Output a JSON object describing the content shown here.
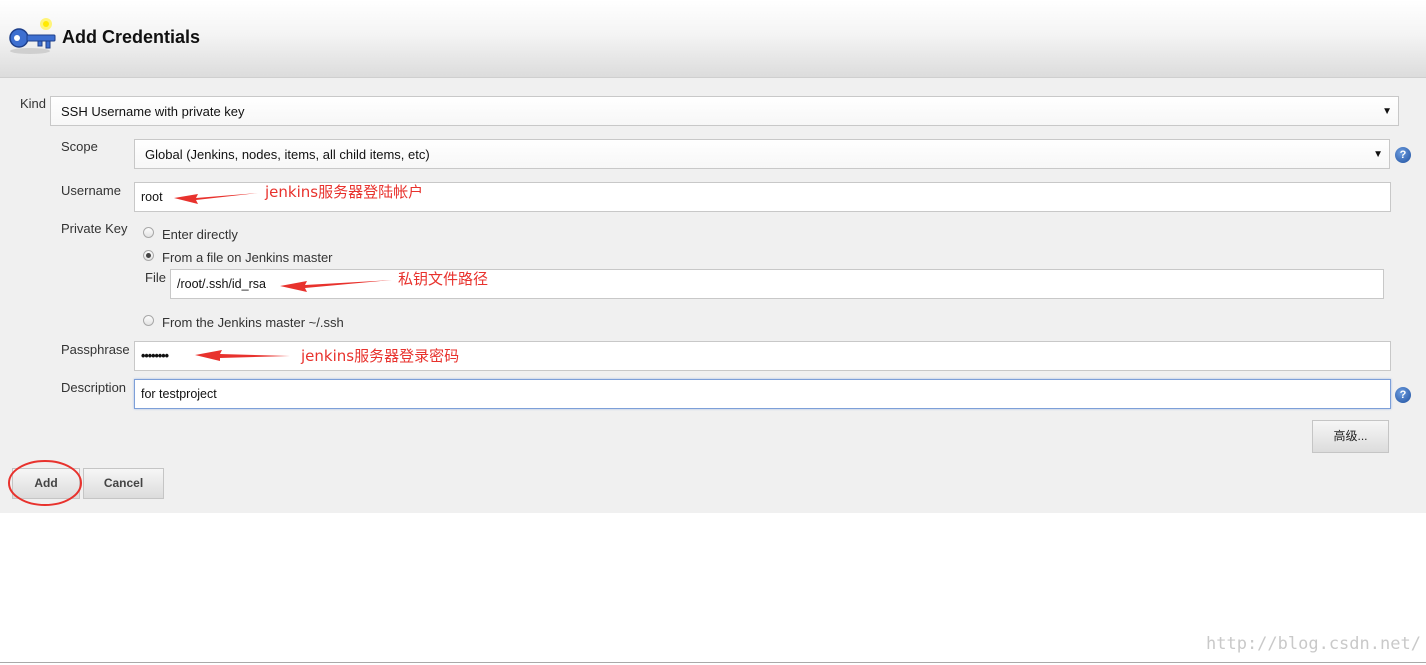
{
  "header": {
    "title": "Add Credentials"
  },
  "form": {
    "kind_label": "Kind",
    "kind_value": "SSH Username with private key",
    "scope_label": "Scope",
    "scope_value": "Global (Jenkins, nodes, items, all child items, etc)",
    "username_label": "Username",
    "username_value": "root",
    "private_key_label": "Private Key",
    "pk_options": [
      "Enter directly",
      "From a file on Jenkins master",
      "From the Jenkins master ~/.ssh"
    ],
    "pk_selected": "From a file on Jenkins master",
    "file_label": "File",
    "file_value": "/root/.ssh/id_rsa",
    "passphrase_label": "Passphrase",
    "passphrase_value": "••••••••",
    "description_label": "Description",
    "description_value": "for testproject",
    "advanced_label": "高级..."
  },
  "buttons": {
    "add": "Add",
    "cancel": "Cancel"
  },
  "annotations": {
    "username_note": "jenkins服务器登陆帐户",
    "file_note": "私钥文件路径",
    "passphrase_note": "jenkins服务器登录密码"
  },
  "help_icon_glyph": "?",
  "dropdown_glyph": "▼",
  "watermark": "http://blog.csdn.net/",
  "colors": {
    "annotation": "#e8322d",
    "focus_border": "#7d9fd8",
    "panel_bg": "#f0f0f0"
  },
  "icons": [
    "key-icon",
    "help-icon",
    "chevron-down-icon"
  ]
}
